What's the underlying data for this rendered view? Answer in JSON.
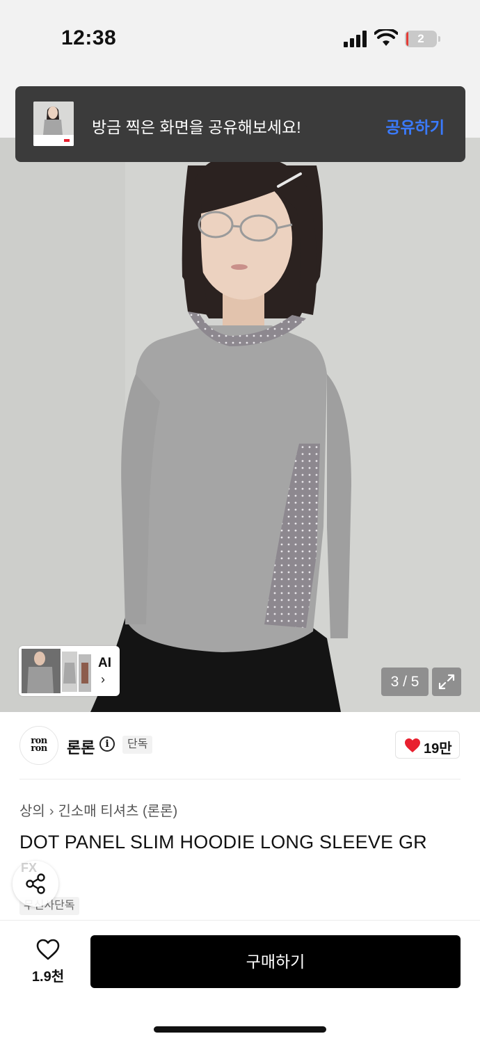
{
  "status_bar": {
    "time": "12:38",
    "battery_level": "2"
  },
  "toast": {
    "message": "방금 찍은 화면을 공유해보세요!",
    "action_label": "공유하기"
  },
  "gallery": {
    "ai_label": "AI",
    "ai_chevron": "›",
    "counter": "3 / 5"
  },
  "brand": {
    "logo_text_line1": "ron",
    "logo_text_line2": "ron",
    "name": "론론",
    "info_glyph": "i",
    "badge": "단독",
    "like_count": "19만"
  },
  "breadcrumb": {
    "category": "상의",
    "separator": "›",
    "subcategory": "긴소매 티셔츠 (론론)"
  },
  "product": {
    "title": "DOT PANEL SLIM HOODIE LONG SLEEVE GR",
    "tag": "무신사단독"
  },
  "fab": {
    "mark": "FX"
  },
  "bottom_bar": {
    "wish_count": "1.9천",
    "buy_label": "구매하기"
  },
  "colors": {
    "accent": "#3a7bff",
    "like_red": "#e8202f",
    "buy_bg": "#000000",
    "toast_bg": "#3b3b3b"
  },
  "icons": [
    "signal-icon",
    "wifi-icon",
    "battery-icon",
    "info-icon",
    "heart-filled-icon",
    "share-icon",
    "heart-outline-icon",
    "expand-icon",
    "chevron-right-icon"
  ]
}
